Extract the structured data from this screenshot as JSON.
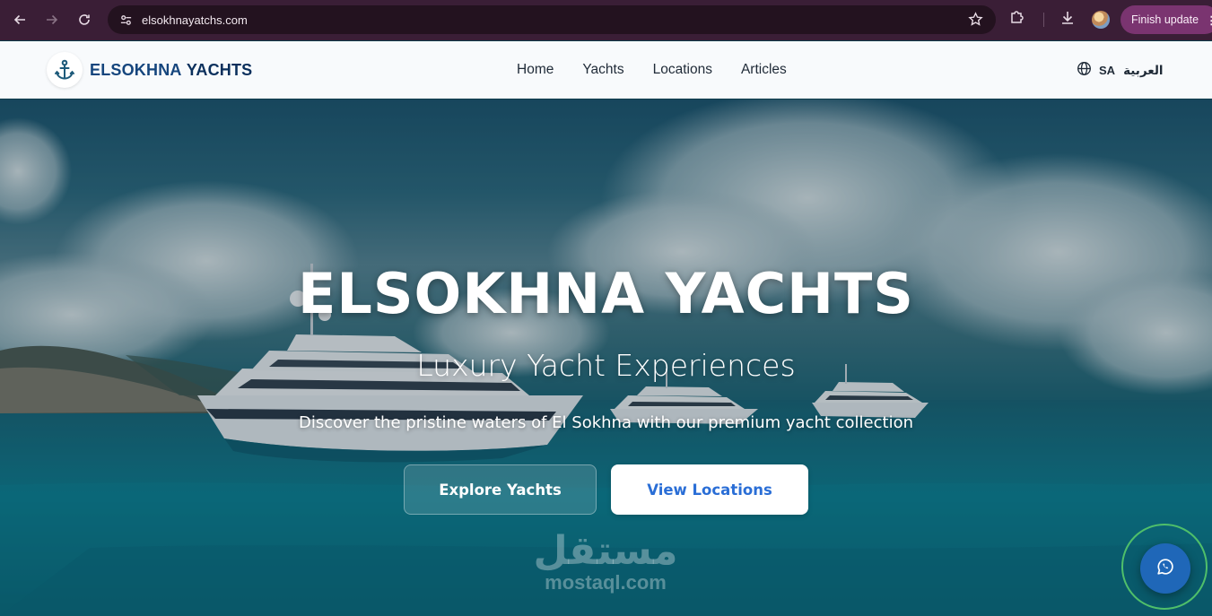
{
  "browser": {
    "url": "elsokhnayatchs.com",
    "finish_update_label": "Finish update",
    "icons": [
      "back-arrow-icon",
      "forward-arrow-icon",
      "reload-icon",
      "site-info-icon",
      "bookmark-star-icon",
      "extensions-icon",
      "download-icon",
      "profile-avatar",
      "more-vert-icon"
    ]
  },
  "header": {
    "brand_light": "ELSOKHNA",
    "brand_bold": "YACHTS",
    "logo_icon": "anchor-icon",
    "nav": [
      {
        "label": "Home"
      },
      {
        "label": "Yachts"
      },
      {
        "label": "Locations"
      },
      {
        "label": "Articles"
      }
    ],
    "lang_code": "SA",
    "lang_label": "العربية",
    "lang_icon": "globe-icon"
  },
  "hero": {
    "title": "ELSOKHNA YACHTS",
    "subtitle": "Luxury Yacht Experiences",
    "description": "Discover the pristine waters of El Sokhna with our premium yacht collection",
    "primary_button": "Explore Yachts",
    "secondary_button": "View Locations"
  },
  "watermark": {
    "arabic": "مستقل",
    "latin": "mostaql.com"
  },
  "floating": {
    "icon": "whatsapp-icon"
  },
  "colors": {
    "chrome_bg": "#3a1e36",
    "brand_navy": "#0a2f5c",
    "link_blue": "#2a6ed6",
    "whatsapp_bg": "#1f67b8",
    "ring_green": "#4fbf6a"
  }
}
